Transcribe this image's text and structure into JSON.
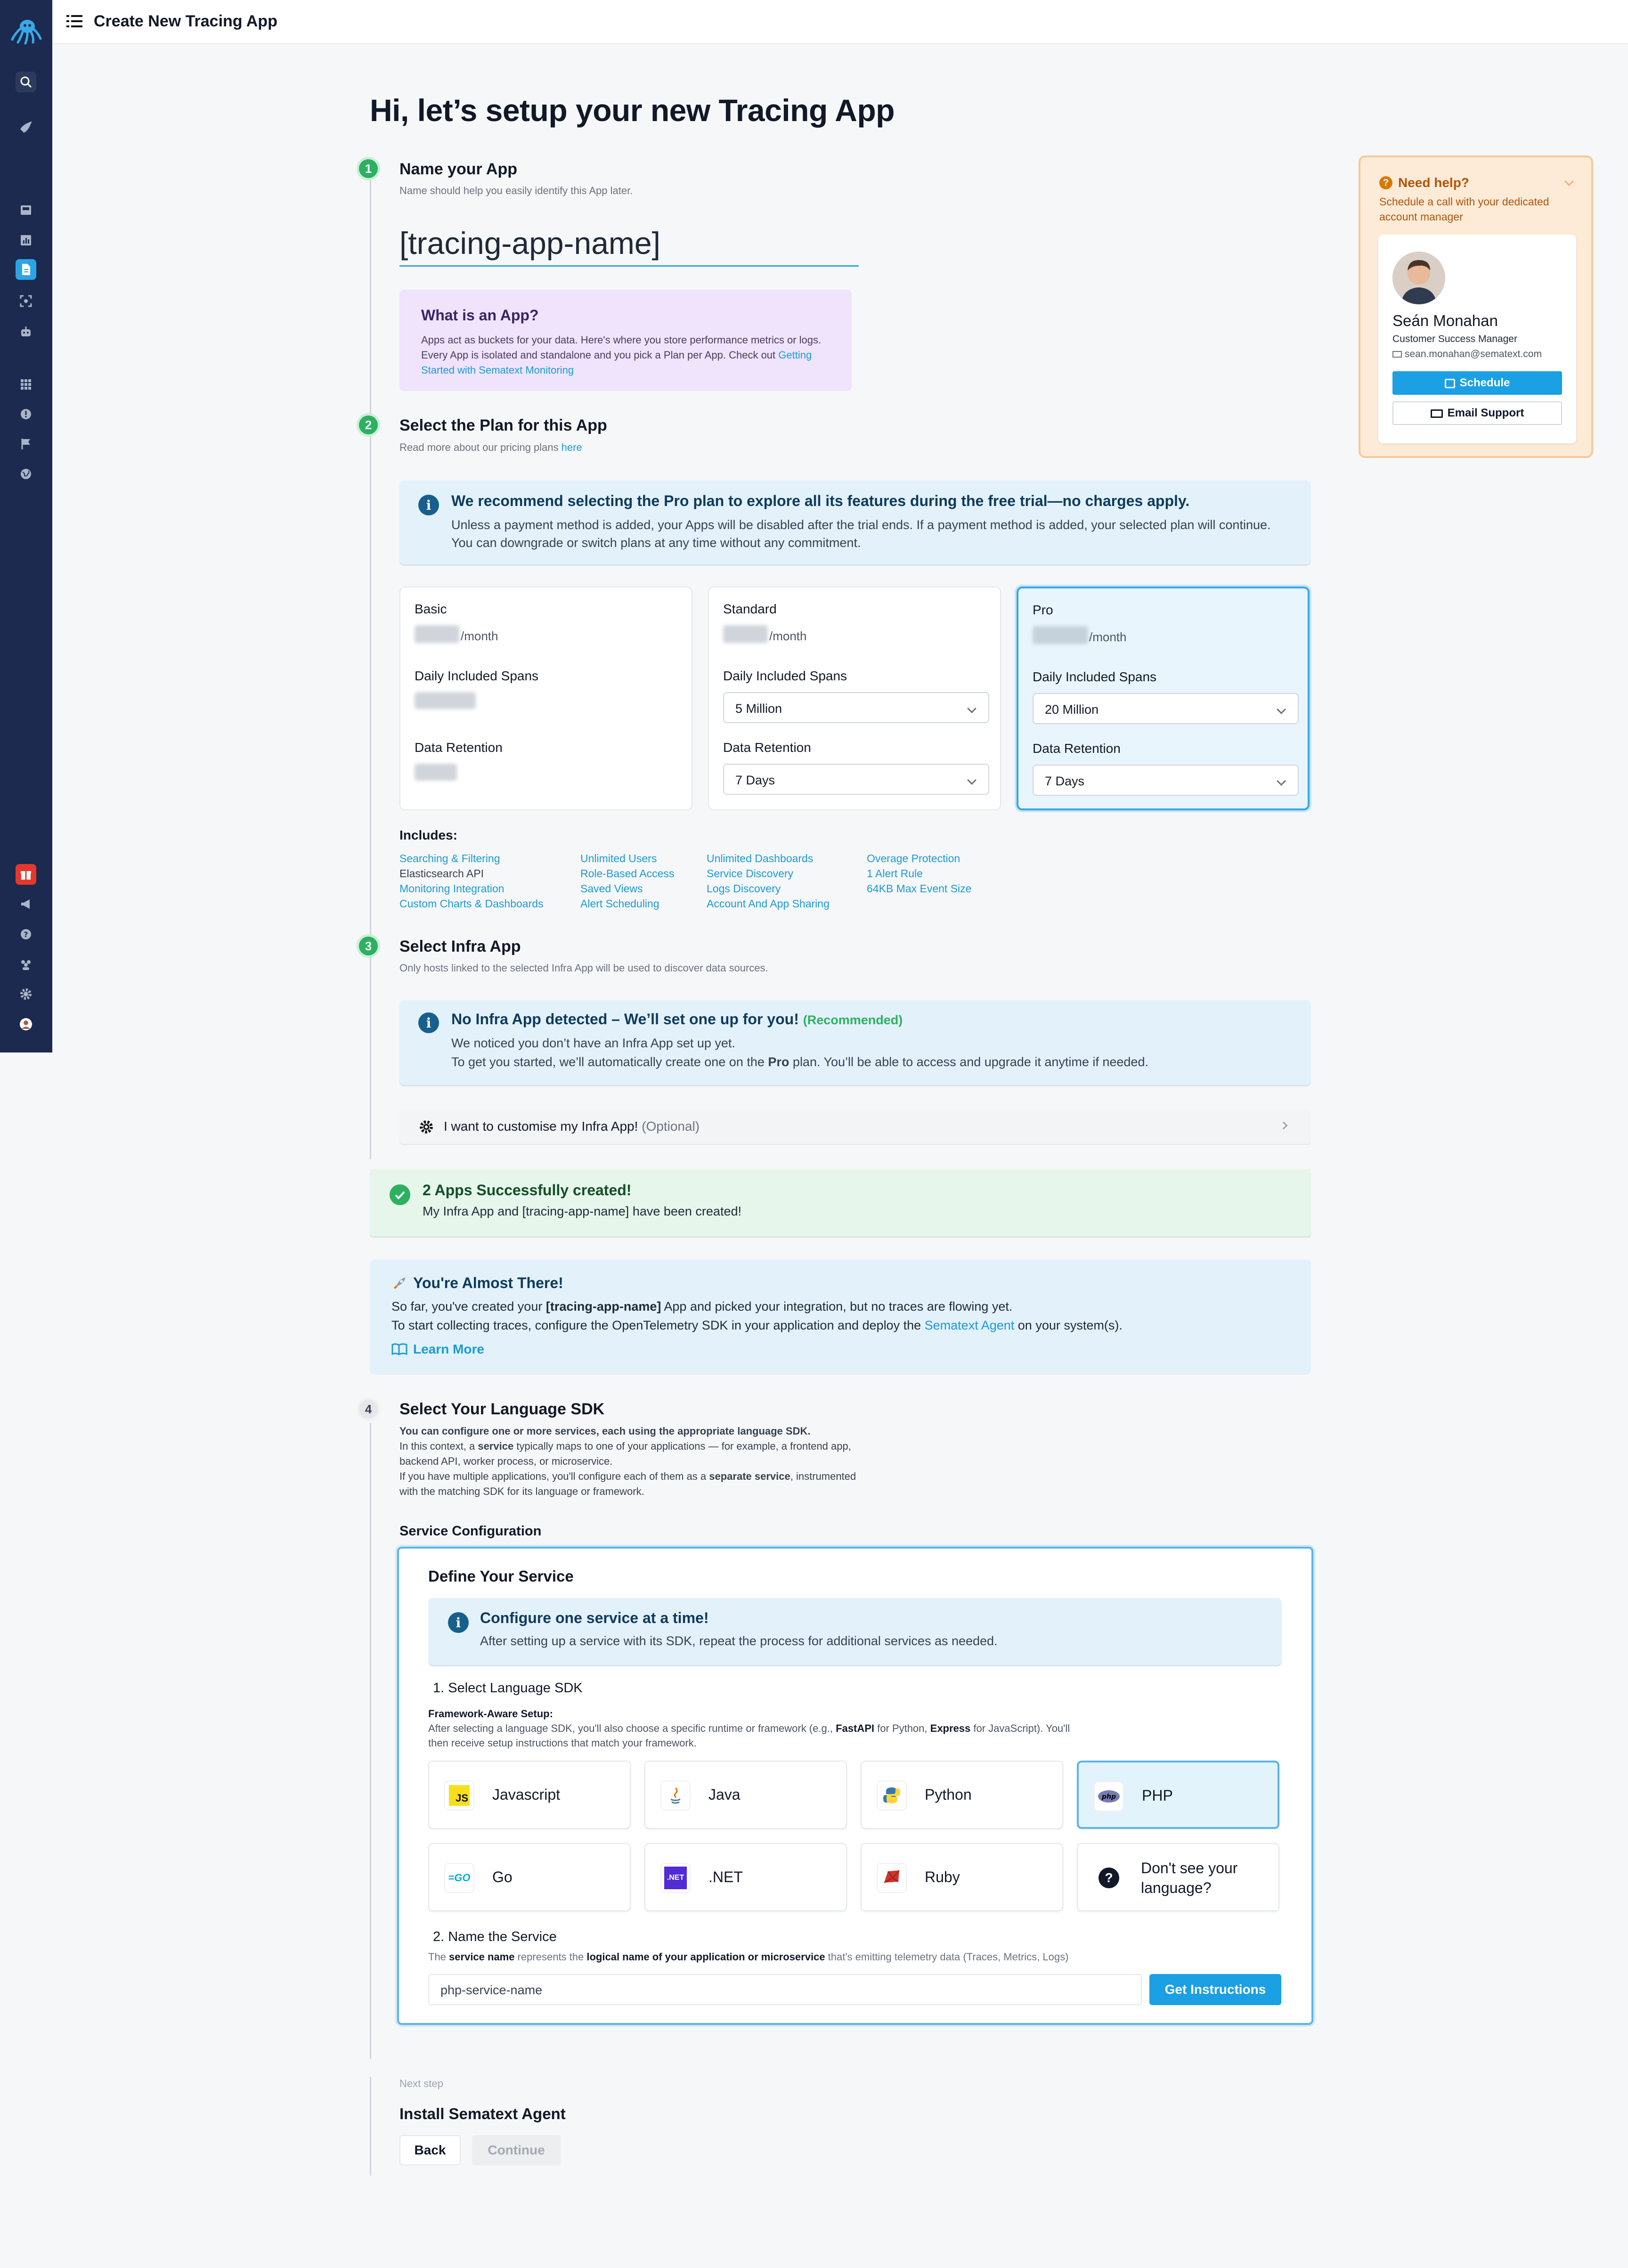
{
  "topbar": {
    "title": "Create New Tracing App"
  },
  "page_title": "Hi, let’s setup your new Tracing App",
  "step1": {
    "number": "1",
    "title": "Name your App",
    "subtitle": "Name should help you easily identify this App later.",
    "app_name_value": "[tracing-app-name]",
    "what_title": "What is an App?",
    "what_text": "Apps act as buckets for your data. Here's where you store performance metrics or logs. Every App is isolated and standalone and you pick a Plan per App. Check out",
    "what_link": "Getting Started with Sematext Monitoring"
  },
  "step2": {
    "number": "2",
    "title": "Select the Plan for this App",
    "subtitle": "Read more about our pricing plans",
    "subtitle_link": "here",
    "rec_title": "We recommend selecting the Pro plan to explore all its features during the free trial—no charges apply.",
    "rec_text": "Unless a payment method is added, your Apps will be disabled after the trial ends. If a payment method is added, your selected plan will continue. You can downgrade or switch plans at any time without any commitment.",
    "plans": [
      {
        "name": "Basic",
        "per": "/month",
        "spans_label": "Daily Included Spans",
        "retention_label": "Data Retention"
      },
      {
        "name": "Standard",
        "per": "/month",
        "spans_label": "Daily Included Spans",
        "spans_value": "5 Million",
        "retention_label": "Data Retention",
        "retention_value": "7 Days"
      },
      {
        "name": "Pro",
        "per": "/month",
        "spans_label": "Daily Included Spans",
        "spans_value": "20 Million",
        "retention_label": "Data Retention",
        "retention_value": "7 Days"
      }
    ],
    "includes_title": "Includes:",
    "includes": [
      [
        "Searching & Filtering",
        "Elasticsearch API",
        "Monitoring Integration",
        "Custom Charts & Dashboards"
      ],
      [
        "Unlimited Users",
        "Role-Based Access",
        "Saved Views",
        "Alert Scheduling"
      ],
      [
        "Unlimited Dashboards",
        "Service Discovery",
        "Logs Discovery",
        "Account And App Sharing"
      ],
      [
        "Overage Protection",
        "1 Alert Rule",
        "64KB Max Event Size"
      ]
    ]
  },
  "step3": {
    "number": "3",
    "title": "Select Infra App",
    "subtitle": "Only hosts linked to the selected Infra App will be used to discover data sources.",
    "notice_title": "No Infra App detected – We’ll set one up for you!",
    "notice_tag": "(Recommended)",
    "notice_line1": "We noticed you don’t have an Infra App set up yet.",
    "notice_line2a": "To get you started, we’ll automatically create one on the",
    "notice_line2b": "Pro",
    "notice_line2c": "plan. You’ll be able to access and upgrade it anytime if needed.",
    "customise_label": "I want to customise my Infra App!",
    "customise_optional": "(Optional)"
  },
  "success": {
    "title": "2 Apps Successfully created!",
    "a": "My Infra App",
    "and": "and",
    "b": "[tracing-app-name]",
    "tail": "have been created!"
  },
  "almost": {
    "title": "You're Almost There!",
    "l1a": "So far, you've created your",
    "l1b": "[tracing-app-name]",
    "l1c": "App and picked your integration, but no traces are flowing yet.",
    "l2a": "To start collecting traces, configure the OpenTelemetry SDK in your application and deploy the",
    "l2b": "Sematext Agent",
    "l2c": "on your system(s).",
    "learn_more": "Learn More"
  },
  "step4": {
    "number": "4",
    "title": "Select Your Language SDK",
    "intro_bold": "You can configure one or more services, each using the appropriate language SDK.",
    "intro_a": "In this context, a",
    "intro_service": "service",
    "intro_b": "typically maps to one of your applications — for example, a frontend app, backend API, worker process, or microservice.",
    "intro_c": "If you have multiple applications, you'll configure each of them as a",
    "intro_sep": "separate service",
    "intro_d": ", instrumented with the matching SDK for its language or framework.",
    "service_config": "Service Configuration",
    "define": "Define Your Service",
    "one_title": "Configure one service at a time!",
    "one_text": "After setting up a service with its SDK, repeat the process for additional services as needed.",
    "select_sdk": "1. Select Language SDK",
    "fw_title": "Framework-Aware Setup:",
    "fw_a": "After selecting a language SDK, you'll also choose a specific runtime or framework (e.g.,",
    "fw_fastapi": "FastAPI",
    "fw_b": "for Python,",
    "fw_express": "Express",
    "fw_c": "for JavaScript). You'll then receive setup instructions that match your framework.",
    "languages": [
      {
        "label": "Javascript",
        "icon": "js-icon"
      },
      {
        "label": "Java",
        "icon": "java-icon"
      },
      {
        "label": "Python",
        "icon": "python-icon"
      },
      {
        "label": "PHP",
        "icon": "php-icon"
      },
      {
        "label": "Go",
        "icon": "go-icon"
      },
      {
        "label": ".NET",
        "icon": "dotnet-icon"
      },
      {
        "label": "Ruby",
        "icon": "ruby-icon"
      },
      {
        "label": "Don't see your language?",
        "icon": "question-icon"
      }
    ],
    "selected_language": "PHP",
    "name_title": "2. Name the Service",
    "name_a": "The",
    "name_b": "service name",
    "name_c": "represents the",
    "name_d": "logical name of your application or microservice",
    "name_e": "that's emitting telemetry data (Traces, Metrics, Logs)",
    "service_name_value": "php-service-name",
    "get_instructions": "Get Instructions"
  },
  "next": {
    "label": "Next step",
    "title": "Install Sematext Agent",
    "back": "Back",
    "continue": "Continue"
  },
  "help": {
    "title": "Need help?",
    "text": "Schedule a call with your dedicated account manager",
    "name": "Seán Monahan",
    "role": "Customer Success Manager",
    "email": "sean.monahan@sematext.com",
    "schedule": "Schedule",
    "email_support": "Email Support"
  },
  "colors": {
    "accent": "#1aa0e3",
    "sidebar": "#1b2a4e",
    "success": "#2bb160",
    "help_bg": "#fdebd7"
  }
}
